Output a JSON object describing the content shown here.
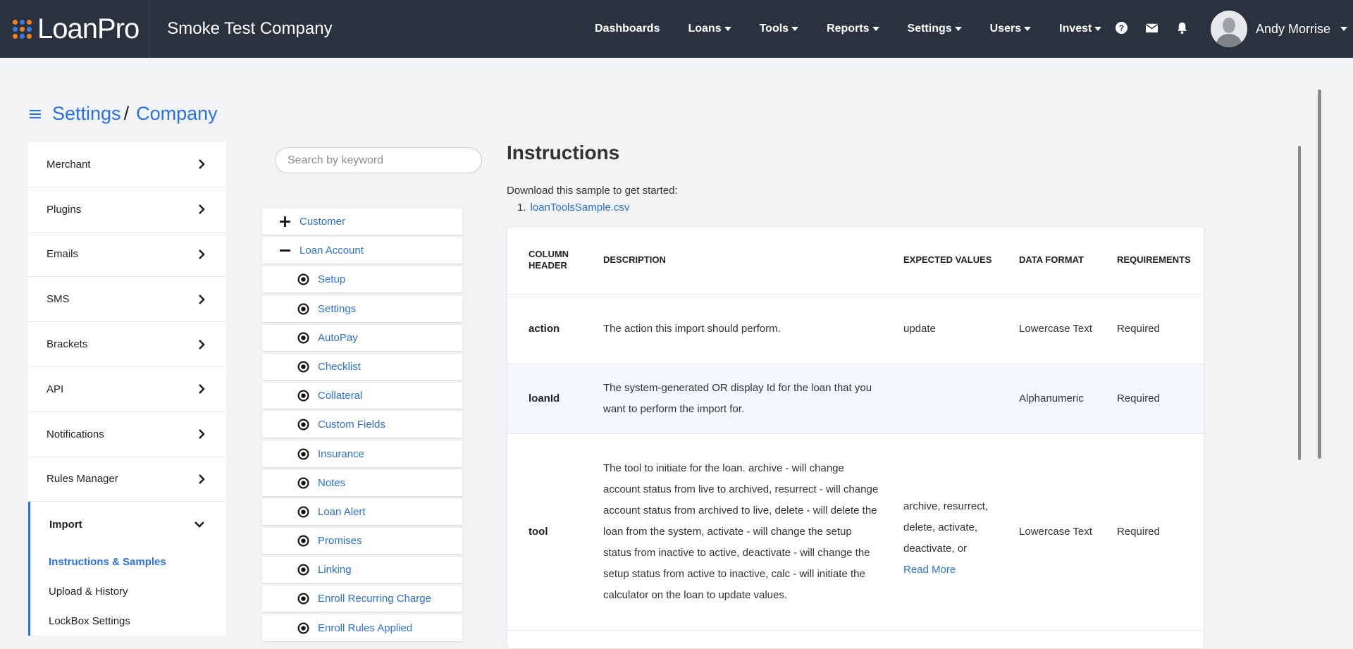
{
  "brand": {
    "logo_text": "LoanPro",
    "company": "Smoke Test Company"
  },
  "nav": [
    {
      "label": "Dashboards",
      "dropdown": false
    },
    {
      "label": "Loans",
      "dropdown": true
    },
    {
      "label": "Tools",
      "dropdown": true
    },
    {
      "label": "Reports",
      "dropdown": true
    },
    {
      "label": "Settings",
      "dropdown": true
    },
    {
      "label": "Users",
      "dropdown": true
    },
    {
      "label": "Invest",
      "dropdown": true
    }
  ],
  "top_icons": [
    "help-icon",
    "mail-icon",
    "bell-icon"
  ],
  "user": {
    "name": "Andy Morrise"
  },
  "breadcrumb": {
    "root": "Settings",
    "sep": "/",
    "current": "Company"
  },
  "menu": {
    "items": [
      "Merchant",
      "Plugins",
      "Emails",
      "SMS",
      "Brackets",
      "API",
      "Notifications",
      "Rules Manager"
    ],
    "active": "Import",
    "subitems": [
      "Instructions & Samples",
      "Upload & History",
      "LockBox Settings"
    ]
  },
  "search": {
    "placeholder": "Search by keyword"
  },
  "tree": {
    "roots": [
      {
        "label": "Customer",
        "expanded": false
      },
      {
        "label": "Loan Account",
        "expanded": true
      }
    ],
    "children": [
      "Setup",
      "Settings",
      "AutoPay",
      "Checklist",
      "Collateral",
      "Custom Fields",
      "Insurance",
      "Notes",
      "Loan Alert",
      "Promises",
      "Linking",
      "Enroll Recurring Charge",
      "Enroll Rules Applied"
    ]
  },
  "instructions": {
    "title": "Instructions",
    "download_text": "Download this sample to get started:",
    "list_number": "1.",
    "sample_file": "loanToolsSample.csv",
    "columns": [
      "COLUMN HEADER",
      "DESCRIPTION",
      "EXPECTED VALUES",
      "DATA FORMAT",
      "REQUIREMENTS"
    ],
    "rows": [
      {
        "name": "action",
        "description": "The action this import should perform.",
        "expected": "update",
        "format": "Lowercase Text",
        "requirement": "Required"
      },
      {
        "name": "loanId",
        "description": "The system-generated OR display Id for the loan that you want to perform the import for.",
        "expected": "",
        "format": "Alphanumeric",
        "requirement": "Required"
      },
      {
        "name": "tool",
        "description": "The tool to initiate for the loan. archive - will change account status from live to archived, resurrect - will change account status from archived to live, delete - will delete the loan from the system, activate - will change the setup status from inactive to active, deactivate - will change the setup status from active to inactive, calc - will initiate the calculator on the loan to update values.",
        "expected": "archive, resurrect, delete, activate, deactivate, or",
        "read_more": "Read More",
        "format": "Lowercase Text",
        "requirement": "Required"
      }
    ]
  },
  "colors": {
    "topbar": "#2a3240",
    "accent": "#2970e8",
    "logo_orange": "#f5821f",
    "logo_blue": "#3a7be0"
  }
}
